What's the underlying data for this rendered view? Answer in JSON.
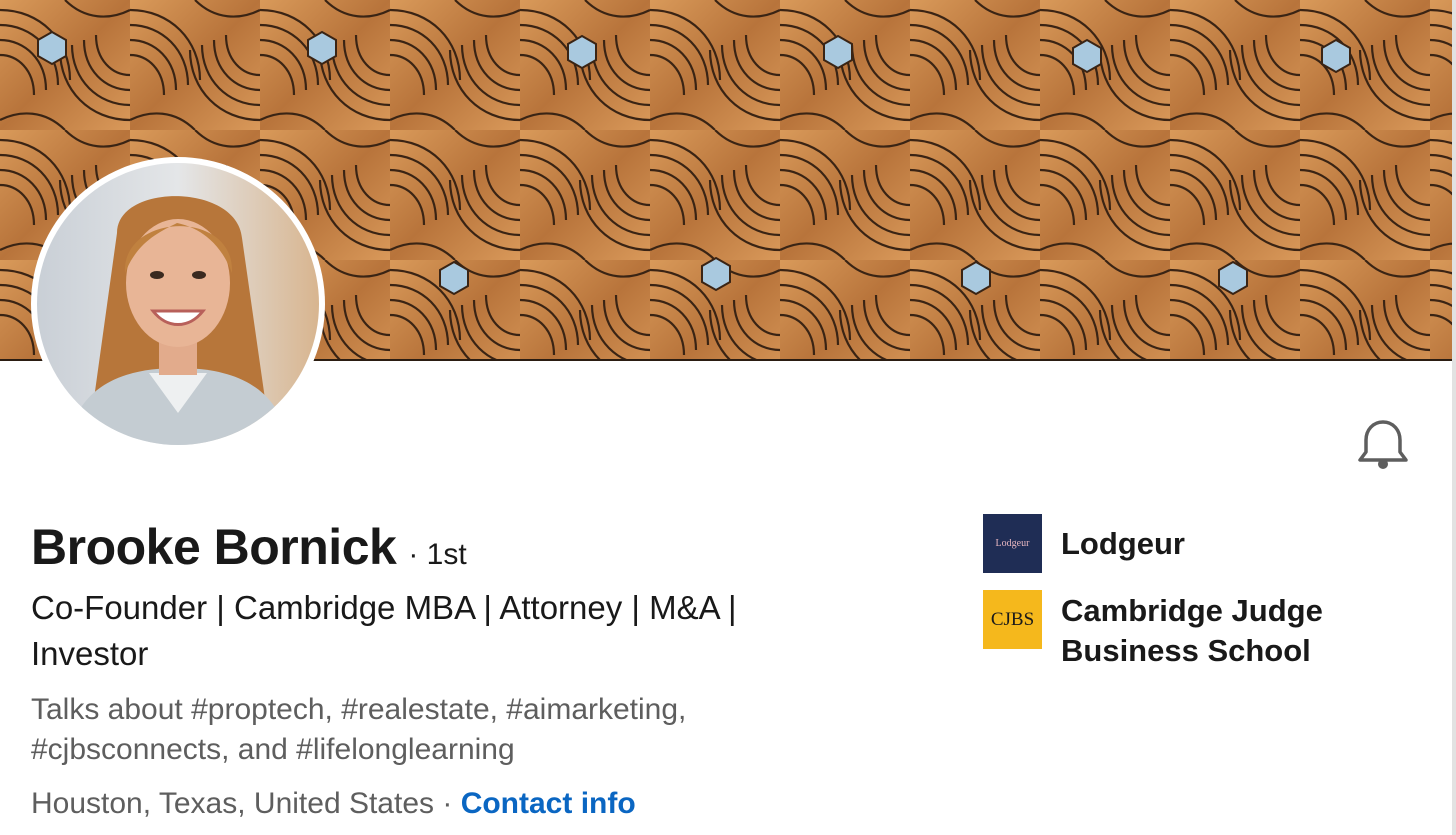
{
  "profile": {
    "name": "Brooke Bornick",
    "degree": "· 1st",
    "headline": "Co-Founder | Cambridge MBA | Attorney | M&A | Investor",
    "talks_about": "Talks about #proptech, #realestate, #aimarketing, #cjbsconnects, and #lifelonglearning",
    "location": "Houston, Texas, United States",
    "separator": " · ",
    "contact_label": "Contact info"
  },
  "organizations": [
    {
      "name": "Lodgeur",
      "logo_text": "Lodgeur",
      "logo_color": "#1f2d55"
    },
    {
      "name": "Cambridge Judge Business School",
      "logo_text": "CJBS",
      "logo_color": "#f5b81c"
    }
  ],
  "icons": {
    "notify": "bell-icon"
  },
  "colors": {
    "link": "#0a66c2",
    "text_primary": "#191919",
    "text_secondary": "#5e5e5e",
    "banner_wood": "#c98a4b",
    "banner_accent": "#9fc3dc"
  }
}
